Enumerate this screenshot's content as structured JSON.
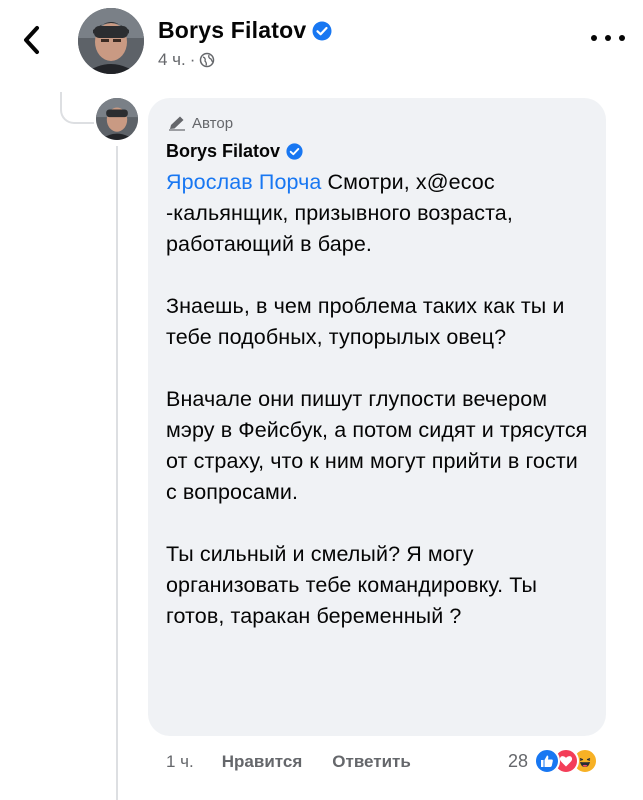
{
  "header": {
    "name": "Borys Filatov",
    "time": "4 ч.",
    "separator": "·"
  },
  "comment": {
    "author_tag": "Автор",
    "name": "Borys Filatov",
    "mention": "Ярослав Порча",
    "text": " Смотри, х@есос -кальянщик, призывного возраста, работающий в баре.\n\nЗнаешь, в чем проблема таких как ты и тебе подобных, тупорылых овец?\n\nВначале они пишут глупости вечером мэру в Фейсбук, а потом сидят и трясутся от страху, что к ним могут прийти в гости с вопросами.\n\nТы сильный и смелый? Я могу организовать тебе командировку. Ты готов, таракан беременный ?"
  },
  "actions": {
    "time": "1 ч.",
    "like_label": "Нравится",
    "reply_label": "Ответить",
    "reaction_count": "28",
    "reactions": [
      "like-reaction",
      "love-reaction",
      "haha-reaction"
    ]
  },
  "colors": {
    "accent": "#1877f2",
    "bubble_bg": "#f0f2f5",
    "secondary_text": "#65676b"
  },
  "icons": {
    "back": "chevron-left-icon",
    "more": "more-dots-icon",
    "verified": "verified-badge-icon",
    "globe": "globe-icon",
    "author": "pencil-icon"
  }
}
